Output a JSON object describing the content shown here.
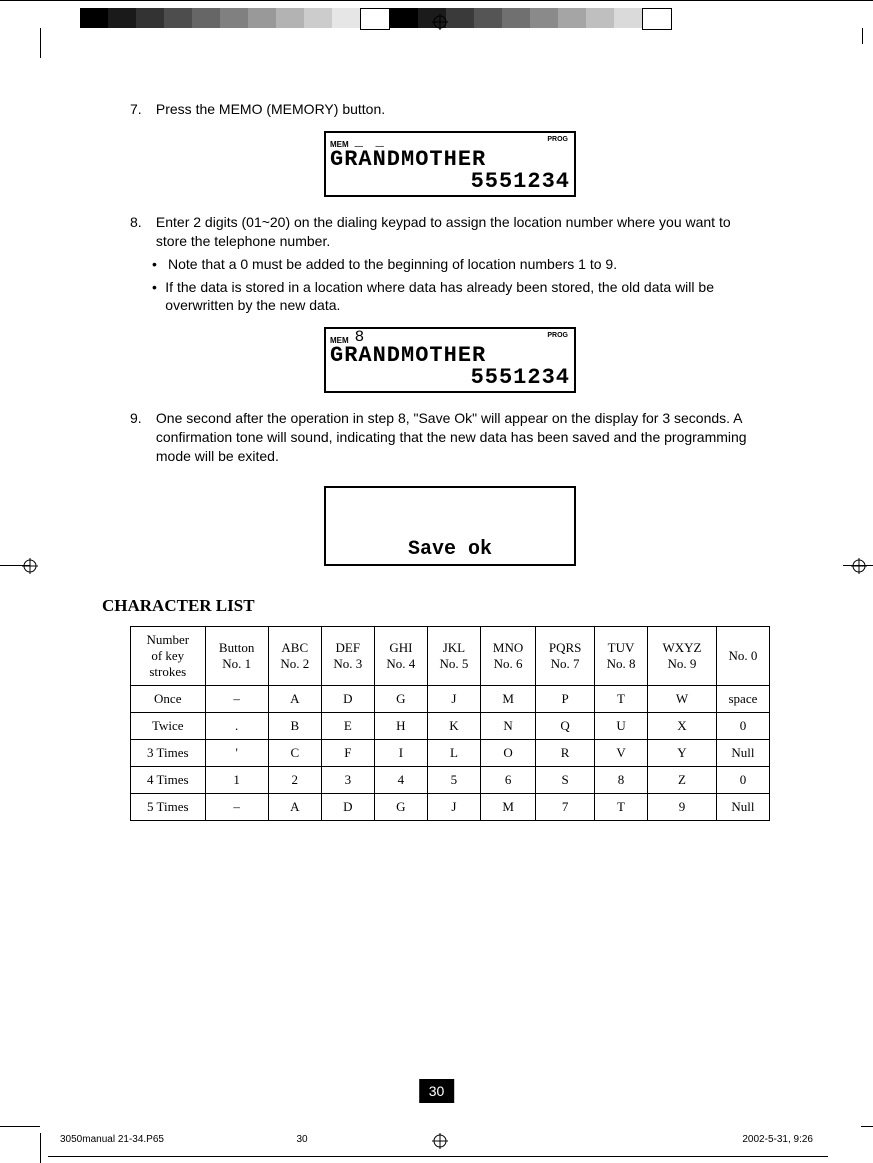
{
  "steps": {
    "s7": {
      "num": "7.",
      "text": "Press the MEMO (MEMORY) button."
    },
    "s8": {
      "num": "8.",
      "text": "Enter 2 digits (01~20) on the dialing keypad to assign the location number where you want to store the telephone number.",
      "b1": "Note that a 0 must be added to the beginning of  location numbers 1 to 9.",
      "b2": "If the data is stored in a location where data has already been stored, the old data will be overwritten by the new data."
    },
    "s9": {
      "num": "9.",
      "text": "One second after the operation in step 8, \"Save Ok\" will appear on the display for 3 seconds. A confirmation tone will sound, indicating that the new data has been saved and the programming mode will be exited."
    }
  },
  "lcd1": {
    "mem": "MEM",
    "dash": "_ _",
    "prog": "PROG",
    "name": "GRANDMOTHER",
    "number": "5551234"
  },
  "lcd2": {
    "mem": "MEM",
    "digit": "8",
    "prog": "PROG",
    "name": "GRANDMOTHER",
    "number": "5551234"
  },
  "lcd3": {
    "msg": "Save ok"
  },
  "char_title": "CHARACTER LIST",
  "char_table": {
    "header": [
      "Number of key strokes",
      "Button No. 1",
      "ABC No. 2",
      "DEF No. 3",
      "GHI No. 4",
      "JKL No. 5",
      "MNO No. 6",
      "PQRS No. 7",
      "TUV No. 8",
      "WXYZ No. 9",
      "No. 0"
    ],
    "rows": [
      [
        "Once",
        "–",
        "A",
        "D",
        "G",
        "J",
        "M",
        "P",
        "T",
        "W",
        "space"
      ],
      [
        "Twice",
        ".",
        "B",
        "E",
        "H",
        "K",
        "N",
        "Q",
        "U",
        "X",
        "0"
      ],
      [
        "3 Times",
        "'",
        "C",
        "F",
        "I",
        "L",
        "O",
        "R",
        "V",
        "Y",
        "Null"
      ],
      [
        "4 Times",
        "1",
        "2",
        "3",
        "4",
        "5",
        "6",
        "S",
        "8",
        "Z",
        "0"
      ],
      [
        "5 Times",
        "–",
        "A",
        "D",
        "G",
        "J",
        "M",
        "7",
        "T",
        "9",
        "Null"
      ]
    ]
  },
  "page_number": "30",
  "footer": {
    "file": "3050manual 21-34.P65",
    "page": "30",
    "date": "2002-5-31, 9:26"
  },
  "colorbar": [
    "#000",
    "#1a1a1a",
    "#333",
    "#4d4d4d",
    "#666",
    "#808080",
    "#999",
    "#b3b3b3",
    "#ccc",
    "#e6e6e6",
    "#fff",
    "#000",
    "#1b1b1b",
    "#3a3a3a",
    "#555",
    "#707070",
    "#8a8a8a",
    "#a5a5a5",
    "#bfbfbf",
    "#dadada",
    "#fff"
  ]
}
